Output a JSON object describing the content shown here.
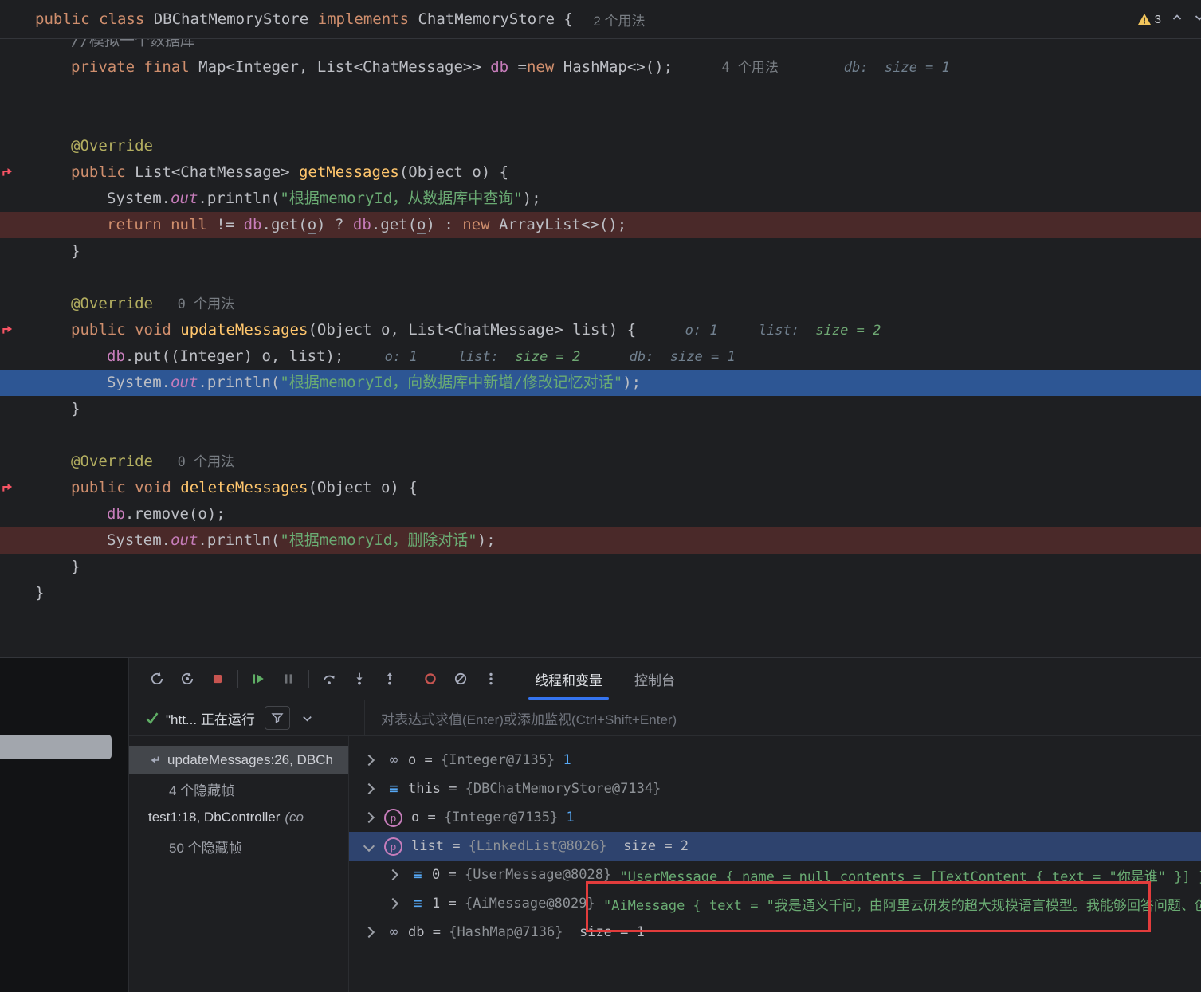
{
  "colors": {
    "accent_blue": "#3574F0",
    "exec_line_blue": "#2D5694",
    "breakpoint_line_red": "#4A2929",
    "selected_row_blue": "#2E436E",
    "stop_red": "#C75450",
    "resume_green": "#5FAD65",
    "warning_yellow": "#F2C55C",
    "string_green": "#6AAB73",
    "keyword_orange": "#CF8E6D",
    "method_yellow": "#FFC66D",
    "field_purple": "#C77DBB"
  },
  "top_bar": {
    "tokens": [
      [
        "kw",
        "public class "
      ],
      [
        "pl",
        "DBChatMemoryStore "
      ],
      [
        "kw",
        "implements "
      ],
      [
        "pl",
        "ChatMemoryStore { "
      ]
    ],
    "usages": "2 个用法",
    "warning_count": "3"
  },
  "editor": {
    "lines": [
      {
        "indent": 1,
        "clip": true,
        "tokens": [
          [
            "co",
            "//模拟一个数据库"
          ]
        ]
      },
      {
        "indent": 1,
        "tokens": [
          [
            "kw",
            "private final "
          ],
          [
            "pl",
            "Map<Integer, List<ChatMessage>> "
          ],
          [
            "fi",
            "db "
          ],
          [
            "pl",
            "="
          ],
          [
            "kw",
            "new"
          ],
          [
            "pl",
            " HashMap<>();"
          ],
          [
            "us",
            "      4 个用法"
          ],
          [
            "hi",
            "        db:  size = 1"
          ]
        ]
      },
      {
        "tokens": []
      },
      {
        "tokens": []
      },
      {
        "indent": 1,
        "tokens": [
          [
            "an",
            "@Override"
          ]
        ]
      },
      {
        "indent": 1,
        "marker": true,
        "tokens": [
          [
            "kw",
            "public "
          ],
          [
            "pl",
            "List<ChatMessage> "
          ],
          [
            "me",
            "getMessages"
          ],
          [
            "pl",
            "(Object o) {"
          ]
        ]
      },
      {
        "indent": 2,
        "tokens": [
          [
            "pl",
            "System."
          ],
          [
            "fio",
            "out"
          ],
          [
            "pl",
            ".println("
          ],
          [
            "st",
            "\"根据memoryId，从数据库中查询\""
          ],
          [
            "pl",
            ");"
          ]
        ]
      },
      {
        "indent": 2,
        "bg": "bp",
        "tokens": [
          [
            "kw",
            "return null "
          ],
          [
            "pl",
            "!= "
          ],
          [
            "fi",
            "db"
          ],
          [
            "pl",
            ".get("
          ],
          [
            "plu",
            "o"
          ],
          [
            "pl",
            ") ? "
          ],
          [
            "fi",
            "db"
          ],
          [
            "pl",
            ".get("
          ],
          [
            "plu",
            "o"
          ],
          [
            "pl",
            ") : "
          ],
          [
            "kw",
            "new"
          ],
          [
            "pl",
            " ArrayList<>();"
          ]
        ]
      },
      {
        "indent": 1,
        "tokens": [
          [
            "pl",
            "}"
          ]
        ]
      },
      {
        "tokens": []
      },
      {
        "indent": 1,
        "tokens": [
          [
            "an",
            "@Override"
          ],
          [
            "us",
            "   0 个用法"
          ]
        ]
      },
      {
        "indent": 1,
        "marker": true,
        "tokens": [
          [
            "kw",
            "public void "
          ],
          [
            "me",
            "updateMessages"
          ],
          [
            "pl",
            "(Object o, List<ChatMessage> list) {"
          ],
          [
            "hi",
            "      o: 1     list:  "
          ],
          [
            "hg",
            "size = 2"
          ]
        ]
      },
      {
        "indent": 2,
        "tokens": [
          [
            "fi",
            "db"
          ],
          [
            "pl",
            ".put((Integer) o, list);"
          ],
          [
            "hi",
            "     o: 1     list:  "
          ],
          [
            "hg",
            "size = 2"
          ],
          [
            "hi",
            "      db:  size = 1"
          ]
        ]
      },
      {
        "indent": 2,
        "bg": "exec",
        "tokens": [
          [
            "pl",
            "System."
          ],
          [
            "fio",
            "out"
          ],
          [
            "pl",
            ".println("
          ],
          [
            "st",
            "\"根据memoryId，向数据库中新增/修改记忆对话\""
          ],
          [
            "pl",
            ");"
          ]
        ]
      },
      {
        "indent": 1,
        "tokens": [
          [
            "pl",
            "}"
          ]
        ]
      },
      {
        "tokens": []
      },
      {
        "indent": 1,
        "tokens": [
          [
            "an",
            "@Override"
          ],
          [
            "us",
            "   0 个用法"
          ]
        ]
      },
      {
        "indent": 1,
        "marker": true,
        "tokens": [
          [
            "kw",
            "public void "
          ],
          [
            "me",
            "deleteMessages"
          ],
          [
            "pl",
            "(Object o) {"
          ]
        ]
      },
      {
        "indent": 2,
        "tokens": [
          [
            "fi",
            "db"
          ],
          [
            "pl",
            ".remove("
          ],
          [
            "plu",
            "o"
          ],
          [
            "pl",
            ");"
          ]
        ]
      },
      {
        "indent": 2,
        "bg": "bp",
        "tokens": [
          [
            "pl",
            "System."
          ],
          [
            "fio",
            "out"
          ],
          [
            "pl",
            ".println("
          ],
          [
            "st",
            "\"根据memoryId，删除对话\""
          ],
          [
            "pl",
            ");"
          ]
        ]
      },
      {
        "indent": 1,
        "tokens": [
          [
            "pl",
            "}"
          ]
        ]
      },
      {
        "indent": 0,
        "tokens": [
          [
            "pl",
            "}"
          ]
        ]
      }
    ]
  },
  "debug": {
    "toolbar_icons": [
      "rerun",
      "rerun-debug",
      "stop",
      "resume",
      "pause",
      "step-over",
      "step-into",
      "step-out",
      "view-breakpoints",
      "mute-breakpoints",
      "more-options"
    ],
    "tabs": [
      {
        "name": "threads-variables",
        "label": "线程和变量",
        "active": true
      },
      {
        "name": "console",
        "label": "控制台",
        "active": false
      }
    ],
    "session": {
      "label": "\"htt... 正在运行"
    },
    "watch_placeholder": "对表达式求值(Enter)或添加监视(Ctrl+Shift+Enter)",
    "frames": [
      {
        "icon": "return-arrow",
        "label": "updateMessages:26, DBCh",
        "selected": true,
        "muted": false
      },
      {
        "label": "4 个隐藏帧",
        "muted": true
      },
      {
        "label": "test1:18, DbController ",
        "suffix": "(co",
        "muted": false
      },
      {
        "label": "50 个隐藏帧",
        "muted": true
      }
    ],
    "variables": [
      {
        "icon": "field",
        "chev": "right",
        "indent": 0,
        "segs": [
          [
            "vn",
            "o"
          ],
          [
            "eq",
            " = "
          ],
          [
            "ref",
            "{Integer@7135}"
          ],
          [
            "num",
            " 1"
          ]
        ]
      },
      {
        "icon": "object",
        "chev": "right",
        "indent": 0,
        "segs": [
          [
            "vn",
            "this"
          ],
          [
            "eq",
            " = "
          ],
          [
            "ref",
            "{DBChatMemoryStore@7134}"
          ]
        ]
      },
      {
        "icon": "param",
        "chev": "right",
        "indent": 0,
        "segs": [
          [
            "vn",
            "o"
          ],
          [
            "eq",
            " = "
          ],
          [
            "ref",
            "{Integer@7135}"
          ],
          [
            "num",
            " 1"
          ]
        ]
      },
      {
        "icon": "param",
        "chev": "down",
        "indent": 0,
        "selected": true,
        "segs": [
          [
            "vn",
            "list"
          ],
          [
            "eq",
            " = "
          ],
          [
            "ref",
            "{LinkedList@8026}"
          ],
          [
            "pl",
            "  size = 2"
          ]
        ]
      },
      {
        "icon": "object",
        "chev": "right",
        "indent": 1,
        "segs": [
          [
            "vn",
            "0"
          ],
          [
            "eq",
            " = "
          ],
          [
            "ref",
            "{UserMessage@8028}"
          ],
          [
            "str",
            " \"UserMessage { name = null contents = [TextContent { text = \"你是谁\" }] }\""
          ]
        ]
      },
      {
        "icon": "object",
        "chev": "right",
        "indent": 1,
        "segs": [
          [
            "vn",
            "1"
          ],
          [
            "eq",
            " = "
          ],
          [
            "ref",
            "{AiMessage@8029}"
          ],
          [
            "str",
            " \"AiMessage { text = \"我是通义千问，由阿里云研发的超大规模语言模型。我能够回答问题、创"
          ]
        ]
      },
      {
        "icon": "field",
        "chev": "right",
        "indent": 0,
        "segs": [
          [
            "vn",
            "db"
          ],
          [
            "eq",
            " = "
          ],
          [
            "ref",
            "{HashMap@7136}"
          ],
          [
            "pl",
            "  size = 1"
          ]
        ]
      }
    ]
  }
}
